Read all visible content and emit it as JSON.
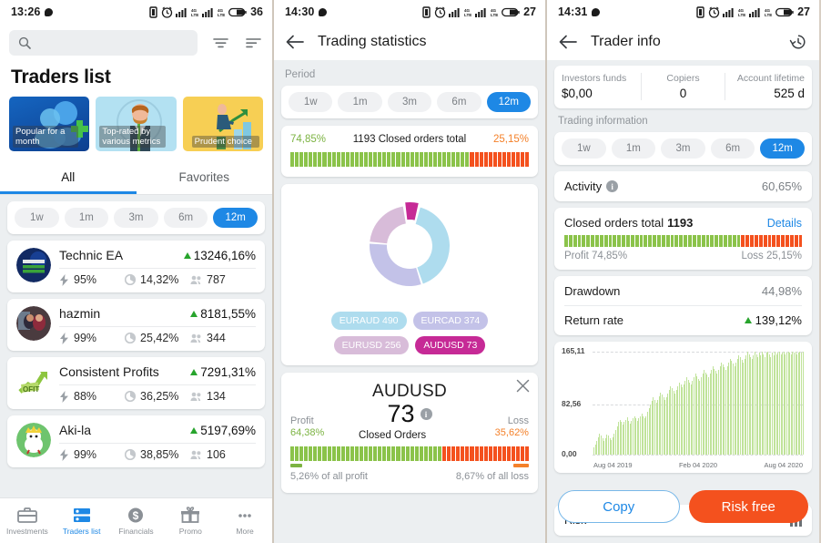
{
  "screen1": {
    "statusbar": {
      "time": "13:26",
      "battery": "36"
    },
    "search": {
      "placeholder": "",
      "value": ""
    },
    "icons": {
      "search": "search-icon",
      "filter": "filter-icon",
      "sort": "sort-icon"
    },
    "page_title": "Traders list",
    "promos": [
      {
        "caption": "Popular for a month"
      },
      {
        "caption": "Top-rated by various metrics"
      },
      {
        "caption": "Prudent choice"
      }
    ],
    "tabs": [
      {
        "label": "All",
        "active": true
      },
      {
        "label": "Favorites",
        "active": false
      }
    ],
    "periods": [
      "1w",
      "1m",
      "3m",
      "6m",
      "12m"
    ],
    "period_active": "12m",
    "traders": [
      {
        "name": "Technic EA",
        "growth": "13246,16%",
        "activity": "95%",
        "drawdown": "14,32%",
        "copiers": "787"
      },
      {
        "name": "hazmin",
        "growth": "8181,55%",
        "activity": "99%",
        "drawdown": "25,42%",
        "copiers": "344"
      },
      {
        "name": "Consistent Profits",
        "growth": "7291,31%",
        "activity": "88%",
        "drawdown": "36,25%",
        "copiers": "134"
      },
      {
        "name": "Aki-la",
        "growth": "5197,69%",
        "activity": "99%",
        "drawdown": "38,85%",
        "copiers": "106"
      }
    ],
    "bottomnav": [
      {
        "label": "Investments",
        "icon": "briefcase-icon",
        "active": false
      },
      {
        "label": "Traders list",
        "icon": "list-icon",
        "active": true
      },
      {
        "label": "Financials",
        "icon": "dollar-icon",
        "active": false
      },
      {
        "label": "Promo",
        "icon": "gift-icon",
        "active": false
      },
      {
        "label": "More",
        "icon": "more-icon",
        "active": false
      }
    ]
  },
  "screen2": {
    "statusbar": {
      "time": "14:30",
      "battery": "27"
    },
    "title": "Trading statistics",
    "back_icon": "back-arrow-icon",
    "period_label": "Period",
    "periods": [
      "1w",
      "1m",
      "3m",
      "6m",
      "12m"
    ],
    "period_active": "12m",
    "orders": {
      "profit_pct": "74,85%",
      "loss_pct": "25,15%",
      "center": "1193 Closed orders total"
    },
    "symbol_card": {
      "name": "AUDUSD",
      "count": "73",
      "count_label": "Closed Orders",
      "profit_label": "Profit",
      "profit_pct": "64,38%",
      "loss_label": "Loss",
      "loss_pct": "35,62%",
      "foot_left": "5,26% of all profit",
      "foot_right": "8,67% of all loss",
      "close_icon": "close-icon",
      "info_icon": "info-icon"
    },
    "chart_data": {
      "type": "pie",
      "title": "",
      "labels": [
        "EURAUD",
        "EURCAD",
        "EURUSD",
        "AUDUSD"
      ],
      "values": [
        490,
        374,
        256,
        73
      ],
      "colors": [
        "#aedcee",
        "#c3c2e8",
        "#d8bcd9",
        "#c62a96"
      ],
      "legend": [
        {
          "text": "EURAUD 490",
          "color": "#aedcee"
        },
        {
          "text": "EURCAD 374",
          "color": "#c3c2e8"
        },
        {
          "text": "EURUSD 256",
          "color": "#d8bcd9"
        },
        {
          "text": "AUDUSD 73",
          "color": "#c62a96"
        }
      ],
      "legend_position": "bottom"
    }
  },
  "screen3": {
    "statusbar": {
      "time": "14:31",
      "battery": "27"
    },
    "title": "Trader info",
    "back_icon": "back-arrow-icon",
    "history_icon": "history-icon",
    "funds": [
      {
        "label": "Investors funds",
        "value": "$0,00"
      },
      {
        "label": "Copiers",
        "value": "0"
      },
      {
        "label": "Account lifetime",
        "value": "525 d"
      }
    ],
    "trading_info_label": "Trading information",
    "periods": [
      "1w",
      "1m",
      "3m",
      "6m",
      "12m"
    ],
    "period_active": "12m",
    "activity": {
      "label": "Activity",
      "value": "60,65%",
      "info_icon": "info-icon"
    },
    "closed_orders": {
      "label": "Closed orders total",
      "total": "1193",
      "details_label": "Details",
      "profit_text": "Profit 74,85%",
      "loss_text": "Loss 25,15%"
    },
    "metrics": [
      {
        "label": "Drawdown",
        "value": "44,98%"
      },
      {
        "label": "Return rate",
        "value": "139,12%",
        "trend": "up"
      }
    ],
    "risk_strip": {
      "label": "Risk",
      "icon": "bar-chart-icon"
    },
    "cta": {
      "copy": "Copy",
      "risk_free": "Risk free"
    },
    "chart_data": {
      "type": "area",
      "title": "",
      "xlabel": "",
      "ylabel": "",
      "ytick_labels": [
        "165,11",
        "82,56",
        "0,00"
      ],
      "ylim": [
        0,
        165.11
      ],
      "xtick_labels": [
        "Aug 04 2019",
        "Feb 04 2020",
        "Aug 04 2020"
      ],
      "grid": true,
      "color": "#c0e39a",
      "values": [
        12,
        16,
        22,
        28,
        34,
        30,
        26,
        22,
        26,
        32,
        30,
        26,
        24,
        28,
        34,
        40,
        46,
        52,
        56,
        52,
        48,
        52,
        56,
        60,
        54,
        50,
        54,
        58,
        62,
        58,
        54,
        58,
        62,
        66,
        62,
        58,
        62,
        68,
        74,
        80,
        86,
        92,
        88,
        84,
        88,
        94,
        100,
        96,
        92,
        88,
        92,
        98,
        104,
        110,
        106,
        102,
        98,
        104,
        110,
        116,
        112,
        108,
        112,
        118,
        124,
        120,
        116,
        112,
        118,
        124,
        130,
        126,
        122,
        118,
        124,
        130,
        136,
        132,
        128,
        124,
        130,
        136,
        142,
        138,
        134,
        130,
        136,
        142,
        148,
        144,
        140,
        136,
        142,
        148,
        154,
        150,
        146,
        142,
        148,
        154,
        160,
        156,
        152,
        148,
        154,
        160,
        165,
        161,
        157,
        153,
        159,
        165,
        161,
        157,
        163,
        159,
        165,
        161,
        157,
        163,
        165,
        161,
        157,
        163,
        159,
        165,
        161,
        163,
        165,
        161,
        163,
        165,
        161,
        163,
        165,
        163,
        161,
        165,
        163,
        165,
        161,
        163,
        165,
        163,
        165
      ]
    }
  },
  "colors": {
    "accent_blue": "#1e88e5",
    "profit_green": "#7cb342",
    "loss_orange": "#f4812a",
    "risk_orange": "#f4511e"
  }
}
